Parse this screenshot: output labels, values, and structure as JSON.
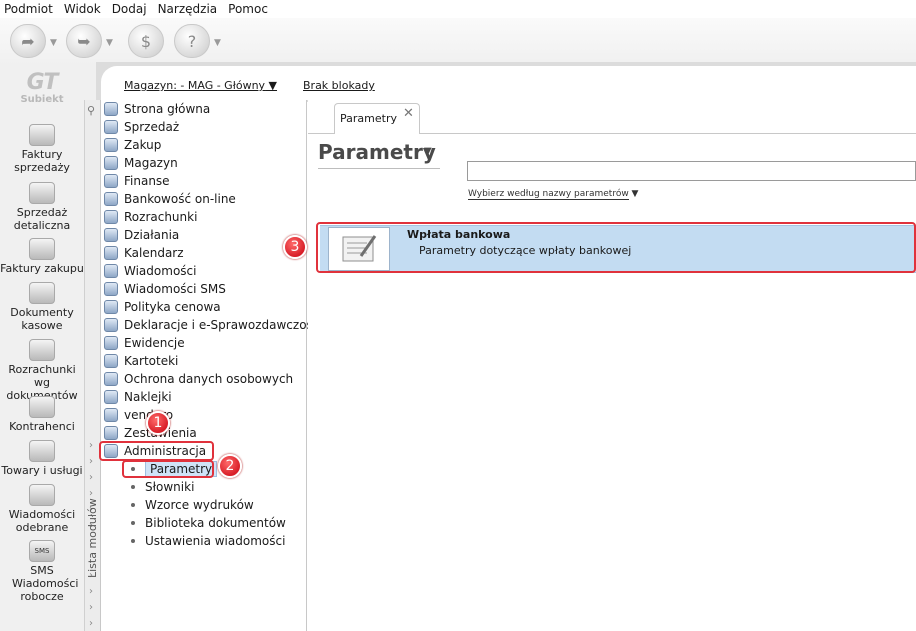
{
  "menu": [
    "Podmiot",
    "Widok",
    "Dodaj",
    "Narzędzia",
    "Pomoc"
  ],
  "logo": {
    "mark": "GT",
    "name": "Subiekt"
  },
  "left_nav": [
    {
      "label": "Faktury sprzedaży",
      "icon": "sales-invoice-icon"
    },
    {
      "label": "Sprzedaż detaliczna",
      "icon": "retail-sale-icon"
    },
    {
      "label": "Faktury zakupu",
      "icon": "purchase-invoice-icon"
    },
    {
      "label": "Dokumenty kasowe",
      "icon": "cash-document-icon"
    },
    {
      "label": "Rozrachunki wg dokumentów",
      "icon": "settlements-icon"
    },
    {
      "label": "Kontrahenci",
      "icon": "contractor-icon"
    },
    {
      "label": "Towary i usługi",
      "icon": "goods-icon"
    },
    {
      "label": "Wiadomości odebrane",
      "icon": "received-messages-icon"
    },
    {
      "label": "SMS Wiadomości robocze",
      "icon": "sms-draft-icon",
      "icon_text": "SMS"
    }
  ],
  "top": {
    "magazyn": "Magazyn: - MAG - Główny",
    "blokada": "Brak blokady"
  },
  "rail_label": "Lista modułów",
  "tree": [
    "Strona główna",
    "Sprzedaż",
    "Zakup",
    "Magazyn",
    "Finanse",
    "Bankowość on-line",
    "Rozrachunki",
    "Działania",
    "Kalendarz",
    "Wiadomości",
    "Wiadomości SMS",
    "Polityka cenowa",
    "Deklaracje i e-Sprawozdawczość",
    "Ewidencje",
    "Kartoteki",
    "Ochrona danych osobowych",
    "Naklejki",
    "vendero",
    "Zestawienia",
    "Administracja"
  ],
  "tree_sub": [
    "Parametry",
    "Słowniki",
    "Wzorce wydruków",
    "Biblioteka dokumentów",
    "Ustawienia wiadomości"
  ],
  "tab": {
    "label": "Parametry",
    "close": "✕"
  },
  "main": {
    "title": "Parametry",
    "search_value": "",
    "filter_label": "Wybierz według nazwy parametrów"
  },
  "result": {
    "title": "Wpłata bankowa",
    "desc": "Parametry dotyczące wpłaty bankowej"
  },
  "badges": [
    "1",
    "2",
    "3"
  ],
  "colors": {
    "selection": "#c3dcf2",
    "callout": "#e0323c"
  }
}
